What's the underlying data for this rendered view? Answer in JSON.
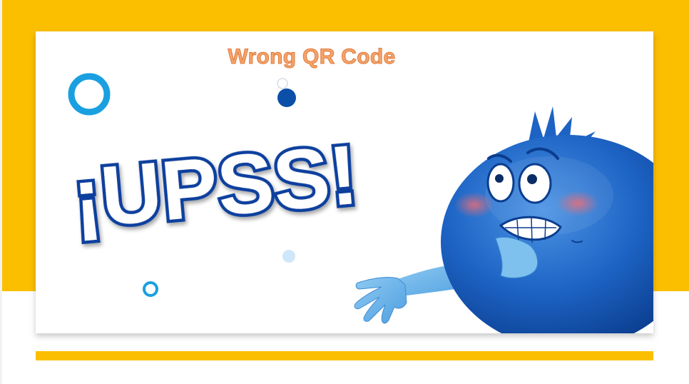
{
  "header": {
    "title": "Wrong QR Code"
  },
  "illustration": {
    "headline": "¡UPSS!",
    "character_icon": "worried-blue-ball-character"
  },
  "colors": {
    "background_band": "#fbbf00",
    "card_background": "#ffffff",
    "title_text": "#f4a46b",
    "title_outline": "#e07a3c",
    "headline_fill": "#ffffff",
    "headline_outline": "#0b3f9e",
    "character_blue": "#1d63c4",
    "ring_blue": "#1aa0e0"
  }
}
